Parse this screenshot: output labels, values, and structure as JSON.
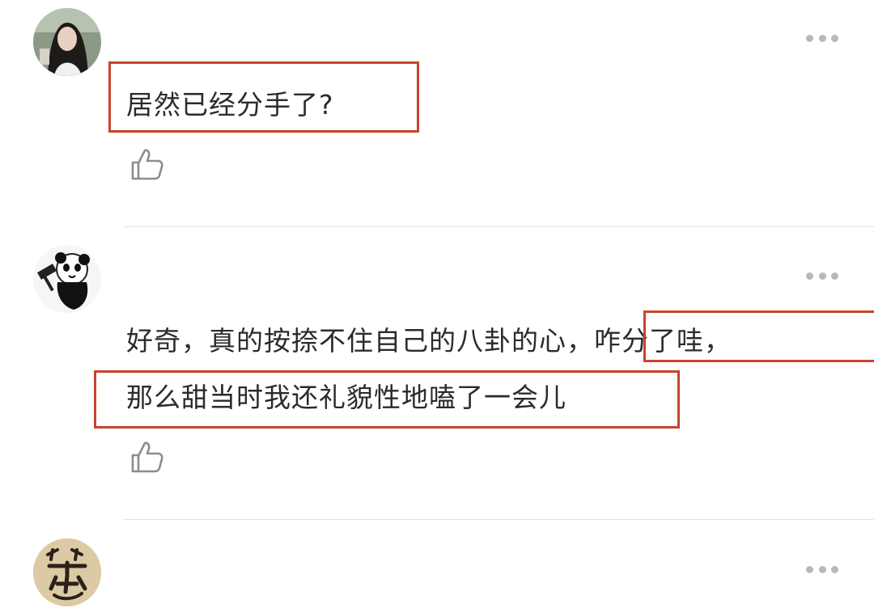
{
  "comments": [
    {
      "text_lines": [
        "居然已经分手了?"
      ],
      "avatar": "photo-avatar-woman-icon"
    },
    {
      "text_lines": [
        "好奇，真的按捺不住自己的八卦的心，咋分了哇，",
        "那么甜当时我还礼貌性地嗑了一会儿"
      ],
      "avatar": "panda-meme-avatar-icon"
    },
    {
      "text_lines": [],
      "avatar": "calligraphy-avatar-icon"
    }
  ],
  "icons": {
    "like": "thumbs-up-icon",
    "more": "more-dots-icon"
  },
  "colors": {
    "highlight_box": "#c8442e",
    "divider": "#e3e3e3",
    "dots": "#b9b9b9"
  }
}
